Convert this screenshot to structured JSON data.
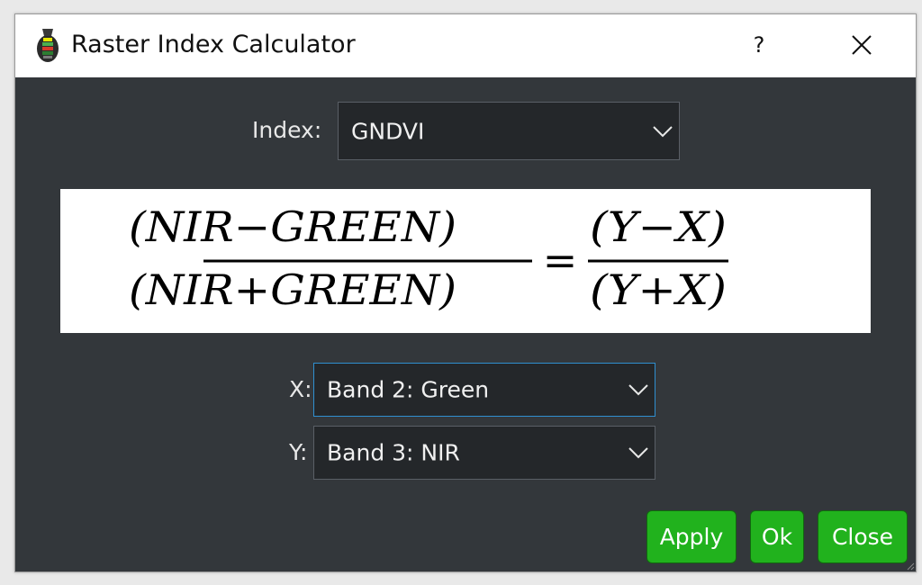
{
  "window": {
    "title": "Raster Index Calculator",
    "help_label": "?"
  },
  "index": {
    "label": "Index:",
    "value": "GNDVI"
  },
  "formula": {
    "left_numerator": "(NIR−GREEN)",
    "left_denominator": "(NIR+GREEN)",
    "equals": "=",
    "right_numerator": "(Y−X)",
    "right_denominator": "(Y+X)"
  },
  "x_band": {
    "label": "X:",
    "value": "Band 2: Green"
  },
  "y_band": {
    "label": "Y:",
    "value": "Band 3: NIR"
  },
  "buttons": {
    "apply": "Apply",
    "ok": "Ok",
    "close": "Close"
  },
  "colors": {
    "dialog_bg": "#33373b",
    "button_green": "#21b21d",
    "focus_blue": "#2f8fd0"
  }
}
